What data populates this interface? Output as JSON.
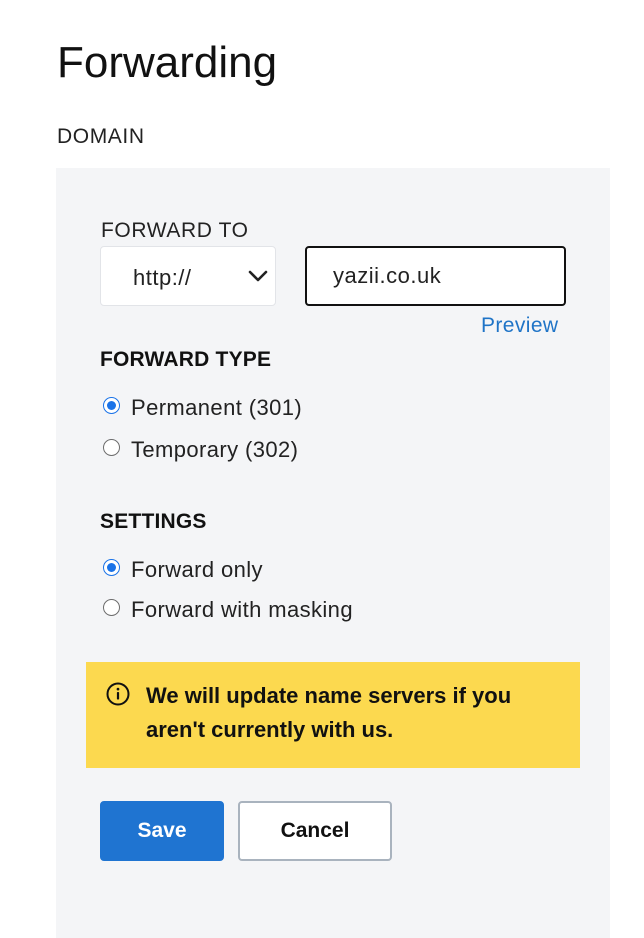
{
  "page": {
    "title": "Forwarding",
    "section_label": "DOMAIN"
  },
  "forward_to": {
    "label": "FORWARD TO",
    "protocol": {
      "selected": "http://",
      "icon": "chevron-down-icon"
    },
    "url_value": "yazii.co.uk",
    "preview_label": "Preview"
  },
  "forward_type": {
    "heading": "FORWARD TYPE",
    "options": [
      {
        "label": "Permanent (301)",
        "checked": true
      },
      {
        "label": "Temporary (302)",
        "checked": false
      }
    ]
  },
  "settings": {
    "heading": "SETTINGS",
    "options": [
      {
        "label": "Forward only",
        "checked": true
      },
      {
        "label": "Forward with masking",
        "checked": false
      }
    ]
  },
  "notice": {
    "icon": "info-icon",
    "text": "We will update name servers if you aren't currently with us.",
    "background": "#fcd94f"
  },
  "actions": {
    "save_label": "Save",
    "cancel_label": "Cancel"
  },
  "colors": {
    "accent": "#1f74d1",
    "link": "#1f74c7",
    "panel": "#f4f5f7",
    "radio_checked": "#1a73e8"
  }
}
